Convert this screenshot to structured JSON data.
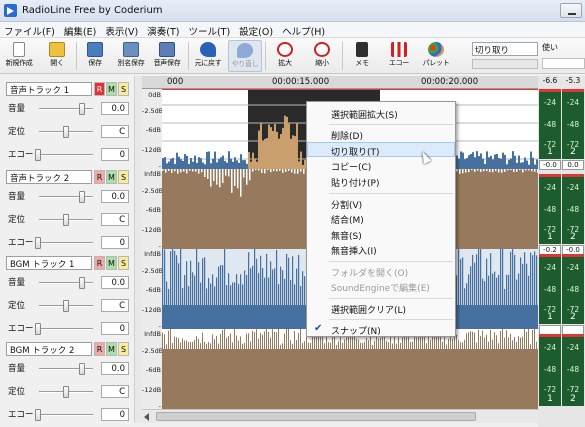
{
  "window": {
    "title": "RadioLine Free by Coderium"
  },
  "menu": [
    "ファイル(F)",
    "編集(E)",
    "表示(V)",
    "演奏(T)",
    "ツール(T)",
    "設定(O)",
    "ヘルプ(H)"
  ],
  "toolbar": {
    "new_label": "新規作成",
    "open_label": "開く",
    "save_label": "保存",
    "save_as_label": "別名保存",
    "audio_save_label": "音声保存",
    "undo_label": "元に戻す",
    "redo_label": "やり直し",
    "zoom_in_label": "拡大",
    "zoom_out_label": "縮小",
    "memo_label": "メモ",
    "eq_label": "エコー",
    "palette_label": "パレット"
  },
  "edit_status": "切り取り",
  "side_box": "使い",
  "ruler": [
    "000",
    "00:00:15.000",
    "00:00:20.000"
  ],
  "db_labels": [
    "0dB",
    "-2.5dB",
    "-6dB",
    "-12dB",
    "-InfdB"
  ],
  "param_labels": {
    "volume": "音量",
    "pan": "定位",
    "echo": "エコー"
  },
  "tracks": [
    {
      "name": "音声トラック 1",
      "r": "R",
      "m": "M",
      "s": "S",
      "volume": "0.0",
      "pan": "C",
      "echo": "0"
    },
    {
      "name": "音声トラック 2",
      "r": "R",
      "m": "M",
      "s": "S",
      "volume": "0.0",
      "pan": "C",
      "echo": "0"
    },
    {
      "name": "BGM トラック 1",
      "r": "R",
      "m": "M",
      "s": "S",
      "volume": "0.0",
      "pan": "C",
      "echo": "0"
    },
    {
      "name": "BGM トラック 2",
      "r": "R",
      "m": "M",
      "s": "S",
      "volume": "0.0",
      "pan": "C",
      "echo": "0"
    }
  ],
  "meters": {
    "top": [
      "-6.6",
      "-5.3"
    ],
    "ticks": [
      "-24",
      "-48",
      "-72"
    ],
    "channels": [
      "1",
      "2"
    ],
    "peaks": [
      [
        "-0.0",
        "0.0"
      ],
      [
        "-0.2",
        "-0.0"
      ],
      [
        "",
        ""
      ]
    ]
  },
  "context_menu": [
    {
      "label": "選択範囲拡大(S)"
    },
    {
      "label": "削除(D)"
    },
    {
      "label": "切り取り(T)",
      "highlight": true
    },
    {
      "label": "コピー(C)"
    },
    {
      "label": "貼り付け(P)"
    },
    {
      "label": "分割(V)"
    },
    {
      "label": "結合(M)"
    },
    {
      "label": "無音(S)"
    },
    {
      "label": "無音挿入(I)"
    },
    {
      "label": "フォルダを開く(O)",
      "disabled": true
    },
    {
      "label": "SoundEngineで編集(E)",
      "disabled": true
    },
    {
      "label": "選択範囲クリア(L)"
    },
    {
      "label": "スナップ(N)",
      "checked": true
    }
  ],
  "colors": {
    "wave_blue": "#46709f",
    "wave_selected": "#c9a06d",
    "wave_brown": "#977a5d",
    "meter_green": "#1d5c2c"
  }
}
